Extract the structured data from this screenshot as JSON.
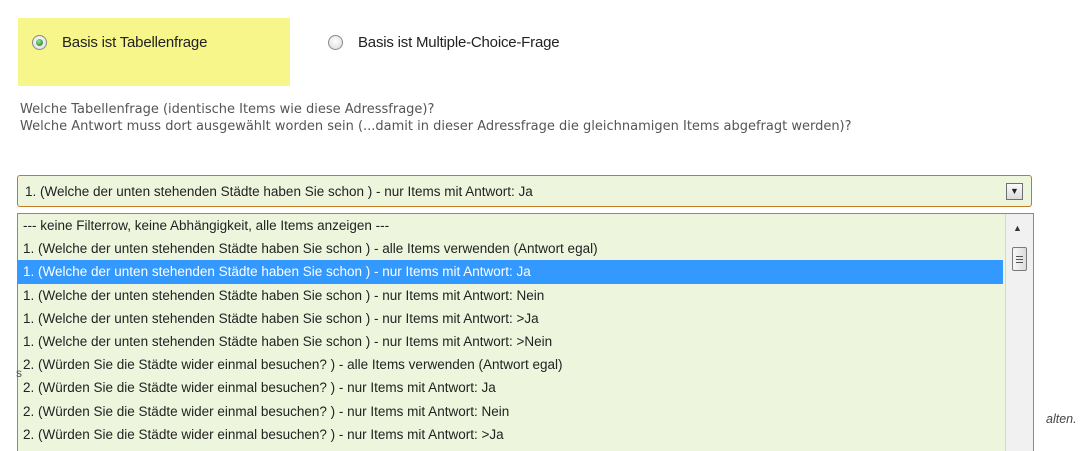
{
  "radio_group": {
    "option1": {
      "label": "Basis ist Tabellenfrage",
      "selected": true
    },
    "option2": {
      "label": "Basis ist Multiple-Choice-Frage",
      "selected": false
    }
  },
  "question": {
    "line1": "Welche Tabellenfrage (identische Items wie diese Adressfrage)?",
    "line2": "Welche Antwort muss dort ausgewählt worden sein (...damit in dieser Adressfrage die gleichnamigen Items abgefragt werden)?"
  },
  "select": {
    "value": "1. (Welche der unten stehenden Städte haben Sie schon ) - nur Items mit Antwort: Ja",
    "options": [
      "--- keine Filterrow, keine Abhängigkeit, alle Items anzeigen ---",
      "1. (Welche der unten stehenden Städte haben Sie schon ) - alle Items verwenden (Antwort egal)",
      "1. (Welche der unten stehenden Städte haben Sie schon ) - nur Items mit Antwort: Ja",
      "1. (Welche der unten stehenden Städte haben Sie schon ) - nur Items mit Antwort: Nein",
      "1. (Welche der unten stehenden Städte haben Sie schon ) - nur Items mit Antwort: >Ja",
      "1. (Welche der unten stehenden Städte haben Sie schon ) - nur Items mit Antwort: >Nein",
      "2. (Würden Sie die Städte wider einmal besuchen? ) - alle Items verwenden (Antwort egal)",
      "2. (Würden Sie die Städte wider einmal besuchen? ) - nur Items mit Antwort: Ja",
      "2. (Würden Sie die Städte wider einmal besuchen? ) - nur Items mit Antwort: Nein",
      "2. (Würden Sie die Städte wider einmal besuchen? ) - nur Items mit Antwort: >Ja"
    ],
    "selected_index": 2
  },
  "background_fragments": {
    "left": "s",
    "right": "alten."
  },
  "colors": {
    "highlight": "#f6f68a",
    "select_bg": "#eef5dd",
    "select_border": "#c47b23",
    "selected_option": "#3399ff"
  }
}
